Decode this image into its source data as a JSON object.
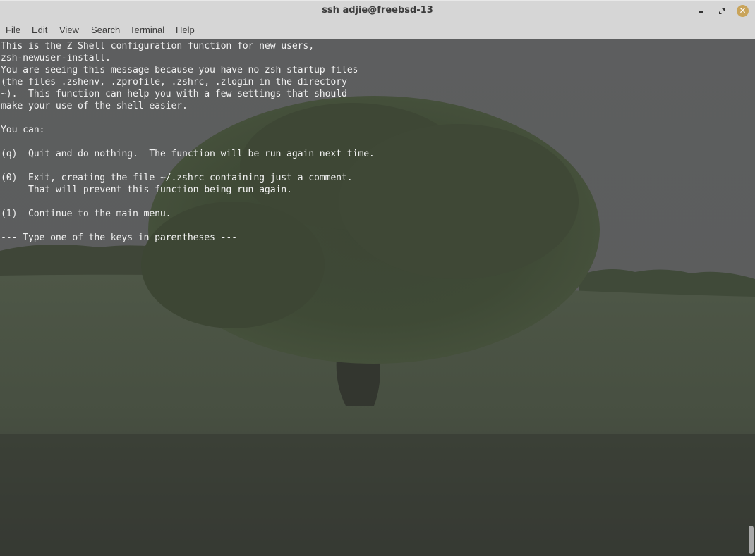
{
  "window": {
    "title": "ssh adjie@freebsd-13",
    "controls": {
      "minimize": "minimize-icon",
      "maximize": "maximize-icon",
      "close": "close-icon",
      "close_color": "#c9a45a"
    }
  },
  "menu": [
    "File",
    "Edit",
    "View",
    "Search",
    "Terminal",
    "Help"
  ],
  "terminal": {
    "lines": [
      "This is the Z Shell configuration function for new users,",
      "zsh-newuser-install.",
      "You are seeing this message because you have no zsh startup files",
      "(the files .zshenv, .zprofile, .zshrc, .zlogin in the directory",
      "~).  This function can help you with a few settings that should",
      "make your use of the shell easier.",
      "",
      "You can:",
      "",
      "(q)  Quit and do nothing.  The function will be run again next time.",
      "",
      "(0)  Exit, creating the file ~/.zshrc containing just a comment.",
      "     That will prevent this function being run again.",
      "",
      "(1)  Continue to the main menu.",
      "",
      "--- Type one of the keys in parentheses ---"
    ],
    "text_color": "#f2f2f2",
    "background": "landscape wallpaper: lone oak tree in a green field under grey sky (dimmed)"
  }
}
